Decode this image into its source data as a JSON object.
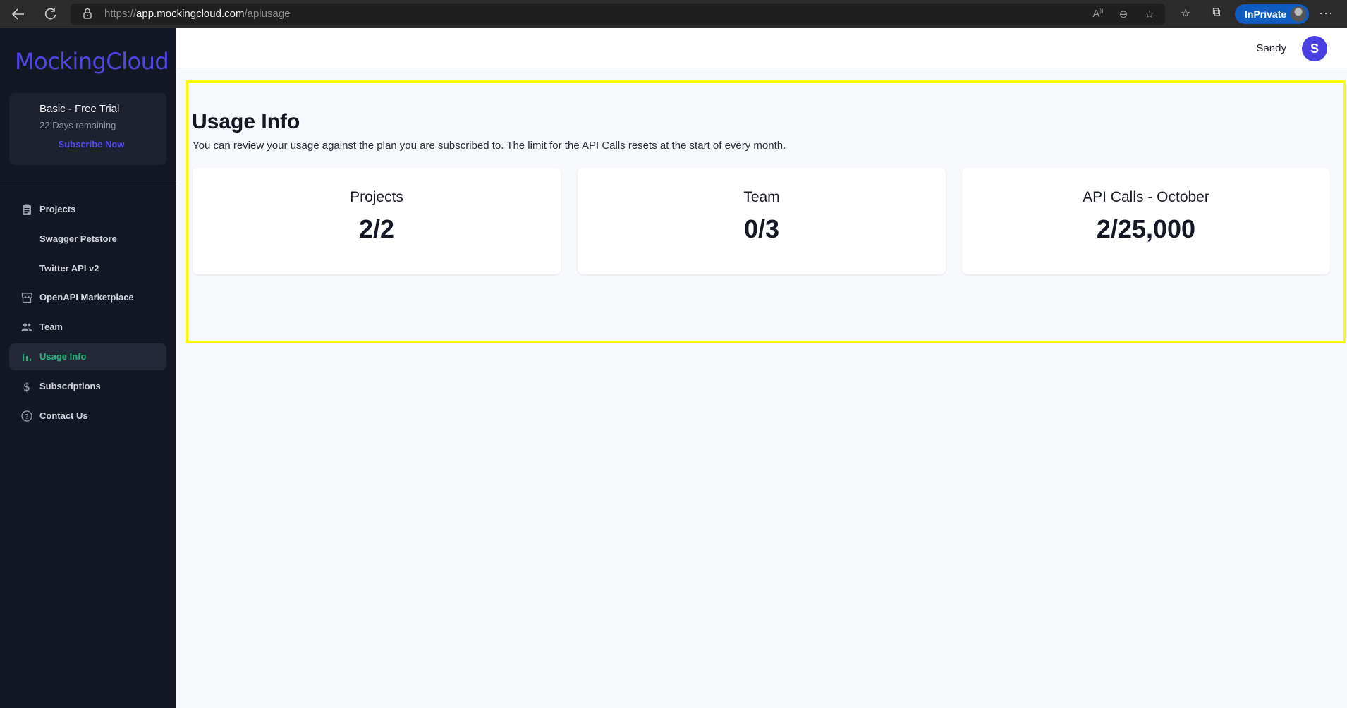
{
  "browser": {
    "url_scheme": "https://",
    "url_host": "app.mockingcloud.com",
    "url_path": "/apiusage",
    "inprivate_label": "InPrivate",
    "icons": [
      "back-icon",
      "refresh-icon",
      "lock-icon",
      "read-aloud-icon",
      "zoom-out-icon",
      "add-favorite-icon",
      "favorites-icon",
      "collections-icon",
      "profile-icon",
      "more-icon"
    ]
  },
  "sidebar": {
    "logo": "MockingCloud",
    "plan": {
      "title": "Basic - Free Trial",
      "days_remaining": "22 Days remaining",
      "subscribe_label": "Subscribe Now"
    },
    "items": [
      {
        "label": "Projects",
        "icon": "clipboard-icon",
        "active": false
      },
      {
        "label": "Swagger Petstore",
        "icon": null,
        "active": false
      },
      {
        "label": "Twitter API v2",
        "icon": null,
        "active": false
      },
      {
        "label": "OpenAPI Marketplace",
        "icon": "store-icon",
        "active": false
      },
      {
        "label": "Team",
        "icon": "people-icon",
        "active": false
      },
      {
        "label": "Usage Info",
        "icon": "bar-chart-icon",
        "active": true
      },
      {
        "label": "Subscriptions",
        "icon": "dollar-icon",
        "active": false
      },
      {
        "label": "Contact Us",
        "icon": "help-circle-icon",
        "active": false
      }
    ]
  },
  "header": {
    "user_name": "Sandy",
    "avatar_initial": "S"
  },
  "main": {
    "title": "Usage Info",
    "description": "You can review your usage against the plan you are subscribed to. The limit for the API Calls resets at the start of every month.",
    "cards": [
      {
        "label": "Projects",
        "value": "2/2"
      },
      {
        "label": "Team",
        "value": "0/3"
      },
      {
        "label": "API Calls - October",
        "value": "2/25,000"
      }
    ]
  },
  "colors": {
    "brand": "#5046e5",
    "active_nav": "#22b57a",
    "sidebar_bg": "#141824",
    "highlight": "#fdfb00"
  }
}
